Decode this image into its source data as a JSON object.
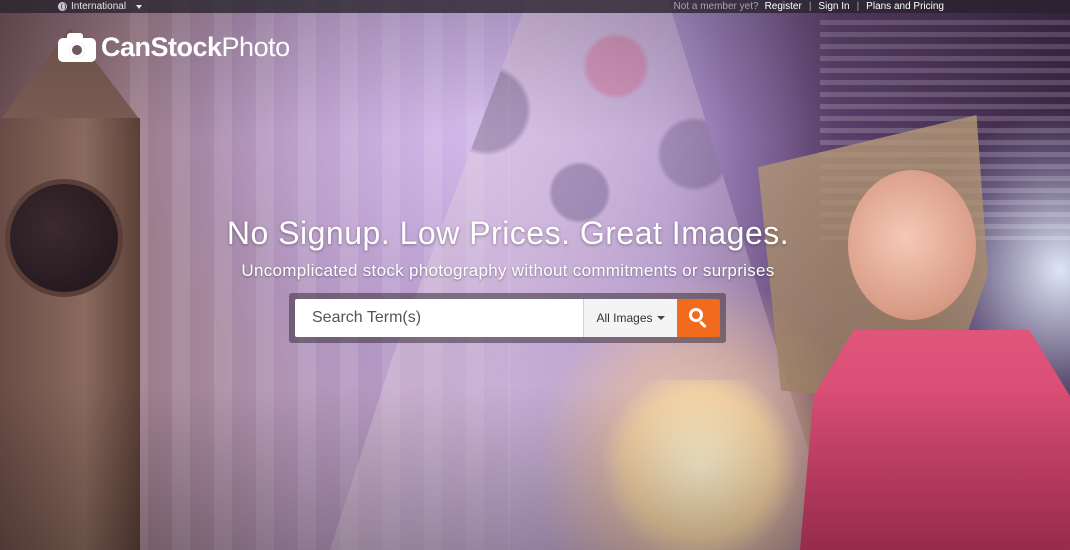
{
  "topbar": {
    "region_label": "International",
    "not_member_text": "Not a member yet?",
    "register_label": "Register",
    "sign_in_label": "Sign In",
    "plans_label": "Plans and Pricing",
    "separator": "|"
  },
  "logo": {
    "part_bold": "CanStock",
    "part_light": "Photo"
  },
  "hero": {
    "headline": "No Signup. Low Prices. Great Images.",
    "subhead": "Uncomplicated stock photography without commitments or surprises"
  },
  "search": {
    "placeholder": "Search Term(s)",
    "category_selected": "All Images",
    "button_icon": "search-icon"
  },
  "colors": {
    "accent": "#f26a1b",
    "topbar_bg": "#28232d",
    "text_on_hero": "#ffffff"
  },
  "icons": {
    "region": "globe-icon",
    "region_menu": "caret-down-icon",
    "logo": "camera-icon",
    "category_menu": "caret-down-icon"
  }
}
